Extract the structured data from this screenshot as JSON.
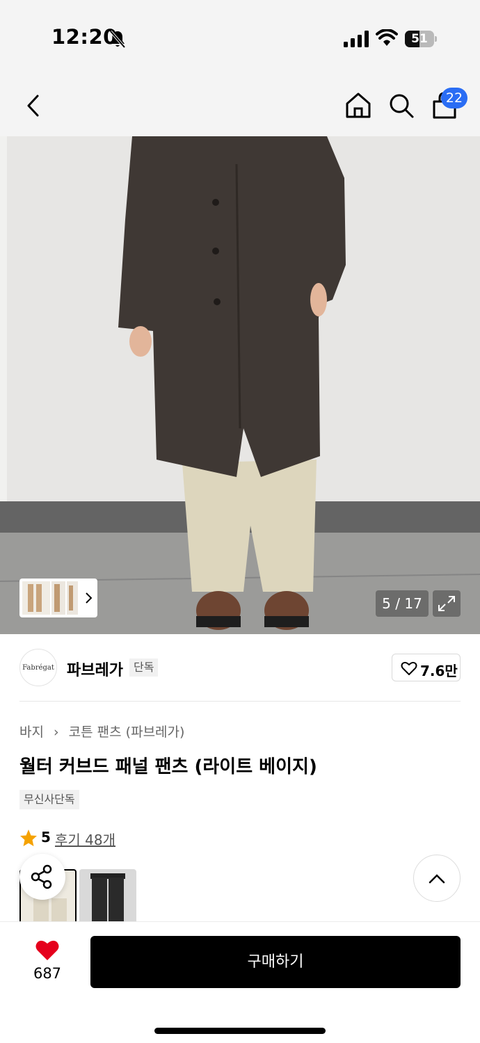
{
  "status_bar": {
    "time": "12:20",
    "battery_level": "51",
    "battery_fraction": 0.51
  },
  "nav": {
    "icons": [
      "chevron-left-icon",
      "home-icon",
      "search-icon",
      "cart-icon"
    ],
    "cart_badge": "22"
  },
  "gallery": {
    "counter": "5 / 17"
  },
  "brand": {
    "logo_text": "Fabrégat",
    "name": "파브레가",
    "tag": "단독",
    "likes": "7.6만"
  },
  "product": {
    "breadcrumb": [
      "바지",
      "코튼 팬츠 (파브레가)"
    ],
    "title": "월터 커브드 패널 팬츠 (라이트 베이지)",
    "exclusive_tag": "무신사단독",
    "rating": "5",
    "reviews": "후기 48개"
  },
  "bottom": {
    "wish_count": "687",
    "buy_label": "구매하기"
  },
  "colors": {
    "accent": "#2a6df4",
    "wish_heart": "#e5001c",
    "star": "#f5a200"
  }
}
